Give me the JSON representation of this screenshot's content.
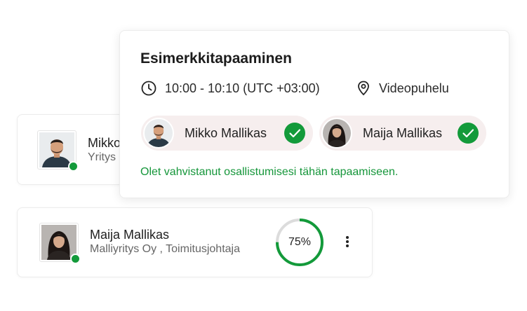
{
  "colors": {
    "accent_green": "#139a3a",
    "confirm_text": "#15963a",
    "pill_bg": "#f6eeee",
    "progress_track": "#dcdcdc"
  },
  "participants": [
    {
      "name": "Mikko",
      "subtitle": "Yritys",
      "status": "online",
      "avatar_icon": "man-avatar-icon"
    },
    {
      "name": "Maija Mallikas",
      "subtitle": "Malliyritys Oy , Toimitusjohtaja",
      "status": "online",
      "avatar_icon": "woman-avatar-icon",
      "progress_label": "75%",
      "progress_value": 0.75,
      "more_icon": "more-vertical-icon"
    }
  ],
  "meeting": {
    "title": "Esimerkkitapaaminen",
    "time": "10:00 - 10:10 (UTC +03:00)",
    "time_icon": "clock-icon",
    "location": "Videopuhelu",
    "location_icon": "location-pin-icon",
    "attendees": [
      {
        "name": "Mikko Mallikas",
        "confirmed": true,
        "icon": "check-circle-icon"
      },
      {
        "name": "Maija Mallikas",
        "confirmed": true,
        "icon": "check-circle-icon"
      }
    ],
    "confirmation": "Olet vahvistanut osallistumisesi tähän tapaamiseen."
  }
}
